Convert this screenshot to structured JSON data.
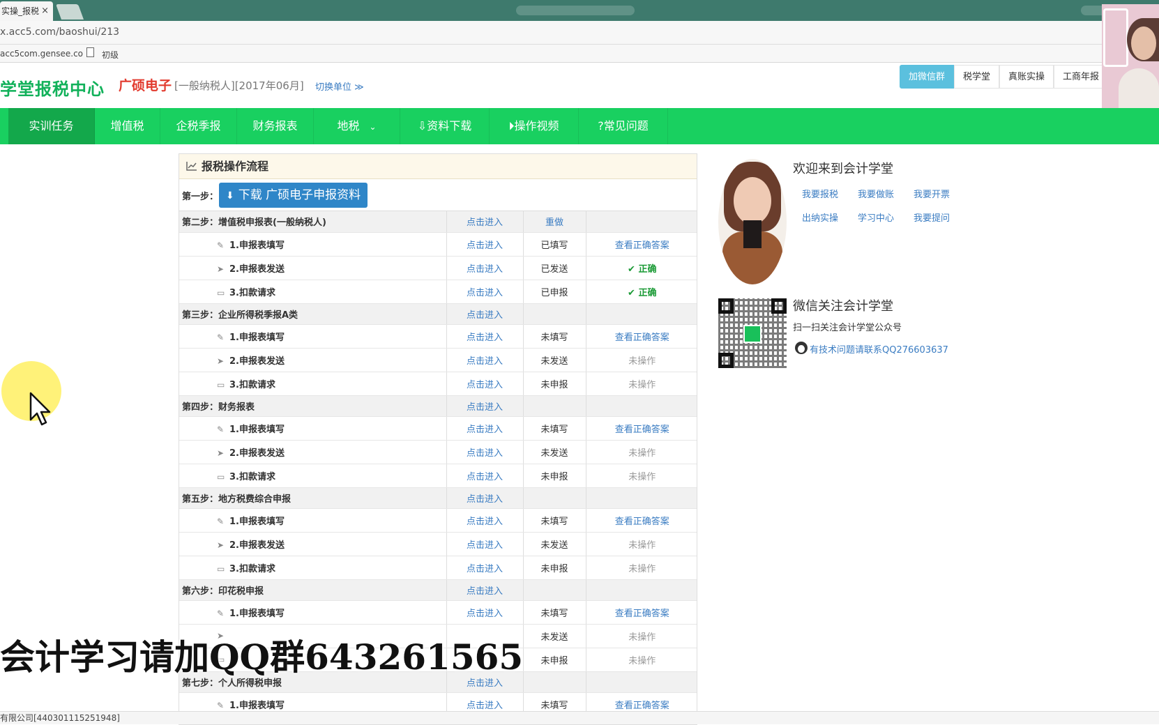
{
  "browser": {
    "tab_title": "实操_报税",
    "tab_close": "×",
    "url": "x.acc5.com/baoshui/213",
    "bookmarks": [
      "acc5com.gensee.co",
      "初级"
    ]
  },
  "header": {
    "brand": "学堂报税中心",
    "company": "广硕电子",
    "company_sub": "[一般纳税人][2017年06月]",
    "switch_unit": "切换单位 ≫",
    "top_links": [
      "加微信群",
      "税学堂",
      "真账实操",
      "工商年报"
    ]
  },
  "nav": {
    "items": [
      "实训任务",
      "增值税",
      "企税季报",
      "财务报表",
      "地税",
      "资料下载",
      "操作视频",
      "常见问题"
    ],
    "icons": {
      "资料下载": "download-icon",
      "操作视频": "play-icon",
      "常见问题": "question-icon"
    }
  },
  "panel": {
    "title": "报税操作流程",
    "step1_label": "第一步：",
    "download_button": "下载 广硕电子申报资料",
    "rows": [
      {
        "type": "step",
        "label": "第二步：增值税申报表(一般纳税人)",
        "action": "点击进入",
        "status": "重做",
        "result": "",
        "status_link": true
      },
      {
        "type": "sub",
        "icon": "edit-icon",
        "label": "1.申报表填写",
        "action": "点击进入",
        "status": "已填写",
        "result": "查看正确答案",
        "result_type": "link"
      },
      {
        "type": "sub",
        "icon": "send-icon",
        "label": "2.申报表发送",
        "action": "点击进入",
        "status": "已发送",
        "result": "✔ 正确",
        "result_type": "ok"
      },
      {
        "type": "sub",
        "icon": "monitor-icon",
        "label": "3.扣款请求",
        "action": "点击进入",
        "status": "已申报",
        "result": "✔ 正确",
        "result_type": "ok"
      },
      {
        "type": "step",
        "label": "第三步：企业所得税季报A类",
        "action": "点击进入",
        "status": "",
        "result": ""
      },
      {
        "type": "sub",
        "icon": "edit-icon",
        "label": "1.申报表填写",
        "action": "点击进入",
        "status": "未填写",
        "result": "查看正确答案",
        "result_type": "link"
      },
      {
        "type": "sub",
        "icon": "send-icon",
        "label": "2.申报表发送",
        "action": "点击进入",
        "status": "未发送",
        "result": "未操作",
        "result_type": "muted"
      },
      {
        "type": "sub",
        "icon": "monitor-icon",
        "label": "3.扣款请求",
        "action": "点击进入",
        "status": "未申报",
        "result": "未操作",
        "result_type": "muted"
      },
      {
        "type": "step",
        "label": "第四步：财务报表",
        "action": "点击进入",
        "status": "",
        "result": ""
      },
      {
        "type": "sub",
        "icon": "edit-icon",
        "label": "1.申报表填写",
        "action": "点击进入",
        "status": "未填写",
        "result": "查看正确答案",
        "result_type": "link"
      },
      {
        "type": "sub",
        "icon": "send-icon",
        "label": "2.申报表发送",
        "action": "点击进入",
        "status": "未发送",
        "result": "未操作",
        "result_type": "muted"
      },
      {
        "type": "sub",
        "icon": "monitor-icon",
        "label": "3.扣款请求",
        "action": "点击进入",
        "status": "未申报",
        "result": "未操作",
        "result_type": "muted"
      },
      {
        "type": "step",
        "label": "第五步：地方税费综合申报",
        "action": "点击进入",
        "status": "",
        "result": ""
      },
      {
        "type": "sub",
        "icon": "edit-icon",
        "label": "1.申报表填写",
        "action": "点击进入",
        "status": "未填写",
        "result": "查看正确答案",
        "result_type": "link"
      },
      {
        "type": "sub",
        "icon": "send-icon",
        "label": "2.申报表发送",
        "action": "点击进入",
        "status": "未发送",
        "result": "未操作",
        "result_type": "muted"
      },
      {
        "type": "sub",
        "icon": "monitor-icon",
        "label": "3.扣款请求",
        "action": "点击进入",
        "status": "未申报",
        "result": "未操作",
        "result_type": "muted"
      },
      {
        "type": "step",
        "label": "第六步：印花税申报",
        "action": "点击进入",
        "status": "",
        "result": ""
      },
      {
        "type": "sub",
        "icon": "edit-icon",
        "label": "1.申报表填写",
        "action": "点击进入",
        "status": "未填写",
        "result": "查看正确答案",
        "result_type": "link"
      },
      {
        "type": "sub",
        "icon": "send-icon",
        "label": "",
        "action": "",
        "status": "未发送",
        "result": "未操作",
        "result_type": "muted"
      },
      {
        "type": "sub",
        "icon": "monitor-icon",
        "label": "",
        "action": "",
        "status": "未申报",
        "result": "未操作",
        "result_type": "muted"
      },
      {
        "type": "step",
        "label": "第七步：个人所得税申报",
        "action": "点击进入",
        "status": "",
        "result": ""
      },
      {
        "type": "sub",
        "icon": "edit-icon",
        "label": "1.申报表填写",
        "action": "点击进入",
        "status": "未填写",
        "result": "查看正确答案",
        "result_type": "link"
      }
    ]
  },
  "sidebar": {
    "welcome": "欢迎来到会计学堂",
    "quick_links": [
      "我要报税",
      "我要做账",
      "我要开票",
      "出纳实操",
      "学习中心",
      "我要提问"
    ],
    "wechat_title": "微信关注会计学堂",
    "wechat_sub": "扫一扫关注会计学堂公众号",
    "qq_text": "有技术问题请联系QQ276603637"
  },
  "overlay": {
    "watermark": "会计学习请加QQ群643261565"
  },
  "status_bar": {
    "text": "有限公司[440301115251948]"
  },
  "colors": {
    "brand_green": "#19d060",
    "nav_active": "#13a84b",
    "link_blue": "#3a7cc2",
    "button_blue": "#2f86c8",
    "ok_green": "#1a9a35",
    "company_red": "#e23a2e"
  }
}
